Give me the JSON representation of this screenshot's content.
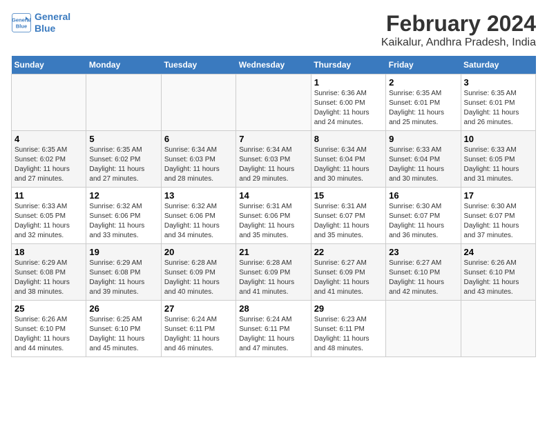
{
  "header": {
    "logo_line1": "General",
    "logo_line2": "Blue",
    "main_title": "February 2024",
    "sub_title": "Kaikalur, Andhra Pradesh, India"
  },
  "weekdays": [
    "Sunday",
    "Monday",
    "Tuesday",
    "Wednesday",
    "Thursday",
    "Friday",
    "Saturday"
  ],
  "weeks": [
    [
      {
        "day": "",
        "info": ""
      },
      {
        "day": "",
        "info": ""
      },
      {
        "day": "",
        "info": ""
      },
      {
        "day": "",
        "info": ""
      },
      {
        "day": "1",
        "info": "Sunrise: 6:36 AM\nSunset: 6:00 PM\nDaylight: 11 hours\nand 24 minutes."
      },
      {
        "day": "2",
        "info": "Sunrise: 6:35 AM\nSunset: 6:01 PM\nDaylight: 11 hours\nand 25 minutes."
      },
      {
        "day": "3",
        "info": "Sunrise: 6:35 AM\nSunset: 6:01 PM\nDaylight: 11 hours\nand 26 minutes."
      }
    ],
    [
      {
        "day": "4",
        "info": "Sunrise: 6:35 AM\nSunset: 6:02 PM\nDaylight: 11 hours\nand 27 minutes."
      },
      {
        "day": "5",
        "info": "Sunrise: 6:35 AM\nSunset: 6:02 PM\nDaylight: 11 hours\nand 27 minutes."
      },
      {
        "day": "6",
        "info": "Sunrise: 6:34 AM\nSunset: 6:03 PM\nDaylight: 11 hours\nand 28 minutes."
      },
      {
        "day": "7",
        "info": "Sunrise: 6:34 AM\nSunset: 6:03 PM\nDaylight: 11 hours\nand 29 minutes."
      },
      {
        "day": "8",
        "info": "Sunrise: 6:34 AM\nSunset: 6:04 PM\nDaylight: 11 hours\nand 30 minutes."
      },
      {
        "day": "9",
        "info": "Sunrise: 6:33 AM\nSunset: 6:04 PM\nDaylight: 11 hours\nand 30 minutes."
      },
      {
        "day": "10",
        "info": "Sunrise: 6:33 AM\nSunset: 6:05 PM\nDaylight: 11 hours\nand 31 minutes."
      }
    ],
    [
      {
        "day": "11",
        "info": "Sunrise: 6:33 AM\nSunset: 6:05 PM\nDaylight: 11 hours\nand 32 minutes."
      },
      {
        "day": "12",
        "info": "Sunrise: 6:32 AM\nSunset: 6:06 PM\nDaylight: 11 hours\nand 33 minutes."
      },
      {
        "day": "13",
        "info": "Sunrise: 6:32 AM\nSunset: 6:06 PM\nDaylight: 11 hours\nand 34 minutes."
      },
      {
        "day": "14",
        "info": "Sunrise: 6:31 AM\nSunset: 6:06 PM\nDaylight: 11 hours\nand 35 minutes."
      },
      {
        "day": "15",
        "info": "Sunrise: 6:31 AM\nSunset: 6:07 PM\nDaylight: 11 hours\nand 35 minutes."
      },
      {
        "day": "16",
        "info": "Sunrise: 6:30 AM\nSunset: 6:07 PM\nDaylight: 11 hours\nand 36 minutes."
      },
      {
        "day": "17",
        "info": "Sunrise: 6:30 AM\nSunset: 6:07 PM\nDaylight: 11 hours\nand 37 minutes."
      }
    ],
    [
      {
        "day": "18",
        "info": "Sunrise: 6:29 AM\nSunset: 6:08 PM\nDaylight: 11 hours\nand 38 minutes."
      },
      {
        "day": "19",
        "info": "Sunrise: 6:29 AM\nSunset: 6:08 PM\nDaylight: 11 hours\nand 39 minutes."
      },
      {
        "day": "20",
        "info": "Sunrise: 6:28 AM\nSunset: 6:09 PM\nDaylight: 11 hours\nand 40 minutes."
      },
      {
        "day": "21",
        "info": "Sunrise: 6:28 AM\nSunset: 6:09 PM\nDaylight: 11 hours\nand 41 minutes."
      },
      {
        "day": "22",
        "info": "Sunrise: 6:27 AM\nSunset: 6:09 PM\nDaylight: 11 hours\nand 41 minutes."
      },
      {
        "day": "23",
        "info": "Sunrise: 6:27 AM\nSunset: 6:10 PM\nDaylight: 11 hours\nand 42 minutes."
      },
      {
        "day": "24",
        "info": "Sunrise: 6:26 AM\nSunset: 6:10 PM\nDaylight: 11 hours\nand 43 minutes."
      }
    ],
    [
      {
        "day": "25",
        "info": "Sunrise: 6:26 AM\nSunset: 6:10 PM\nDaylight: 11 hours\nand 44 minutes."
      },
      {
        "day": "26",
        "info": "Sunrise: 6:25 AM\nSunset: 6:10 PM\nDaylight: 11 hours\nand 45 minutes."
      },
      {
        "day": "27",
        "info": "Sunrise: 6:24 AM\nSunset: 6:11 PM\nDaylight: 11 hours\nand 46 minutes."
      },
      {
        "day": "28",
        "info": "Sunrise: 6:24 AM\nSunset: 6:11 PM\nDaylight: 11 hours\nand 47 minutes."
      },
      {
        "day": "29",
        "info": "Sunrise: 6:23 AM\nSunset: 6:11 PM\nDaylight: 11 hours\nand 48 minutes."
      },
      {
        "day": "",
        "info": ""
      },
      {
        "day": "",
        "info": ""
      }
    ]
  ]
}
